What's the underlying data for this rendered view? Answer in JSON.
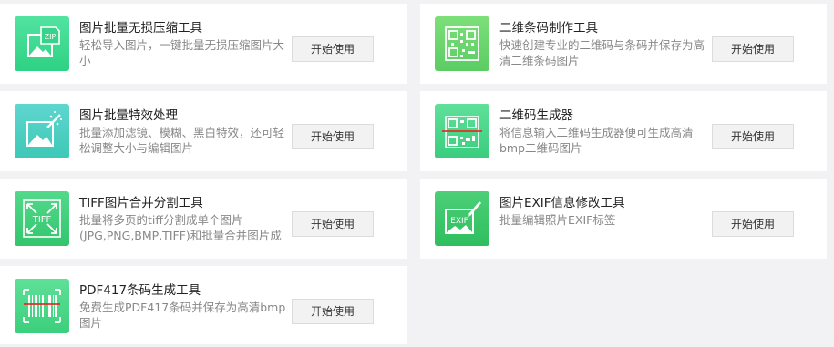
{
  "tools": [
    {
      "title": "图片批量无损压缩工具",
      "desc": "轻松导入图片，一键批量无损压缩图片大小",
      "button": "开始使用",
      "icon": "image-compress-zip-icon",
      "icon_color": "#3fd98f"
    },
    {
      "title": "二维条码制作工具",
      "desc": "快速创建专业的二维码与条码并保存为高清二维条码图片",
      "button": "开始使用",
      "icon": "qr-barcode-icon",
      "icon_color": "#6fd56f"
    },
    {
      "title": "图片批量特效处理",
      "desc": "批量添加滤镜、模糊、黑白特效，还可轻松调整大小与编辑图片",
      "button": "开始使用",
      "icon": "image-effects-wand-icon",
      "icon_color": "#4ccfc6"
    },
    {
      "title": "二维码生成器",
      "desc": "将信息输入二维码生成器便可生成高清bmp二维码图片",
      "button": "开始使用",
      "icon": "qr-code-scan-icon",
      "icon_color": "#4cd88a"
    },
    {
      "title": "TIFF图片合并分割工具",
      "desc": "批量将多页的tiff分割成单个图片(JPG,PNG,BMP,TIFF)和批量合并图片成",
      "button": "开始使用",
      "icon": "tiff-merge-split-icon",
      "icon_color": "#42cf7a"
    },
    {
      "title": "图片EXIF信息修改工具",
      "desc": "批量编辑照片EXIF标签",
      "button": "开始使用",
      "icon": "exif-edit-icon",
      "icon_color": "#38c86a"
    },
    {
      "title": "PDF417条码生成工具",
      "desc": "免费生成PDF417条码并保存为高清bmp图片",
      "button": "开始使用",
      "icon": "pdf417-barcode-icon",
      "icon_color": "#4cd886"
    }
  ]
}
